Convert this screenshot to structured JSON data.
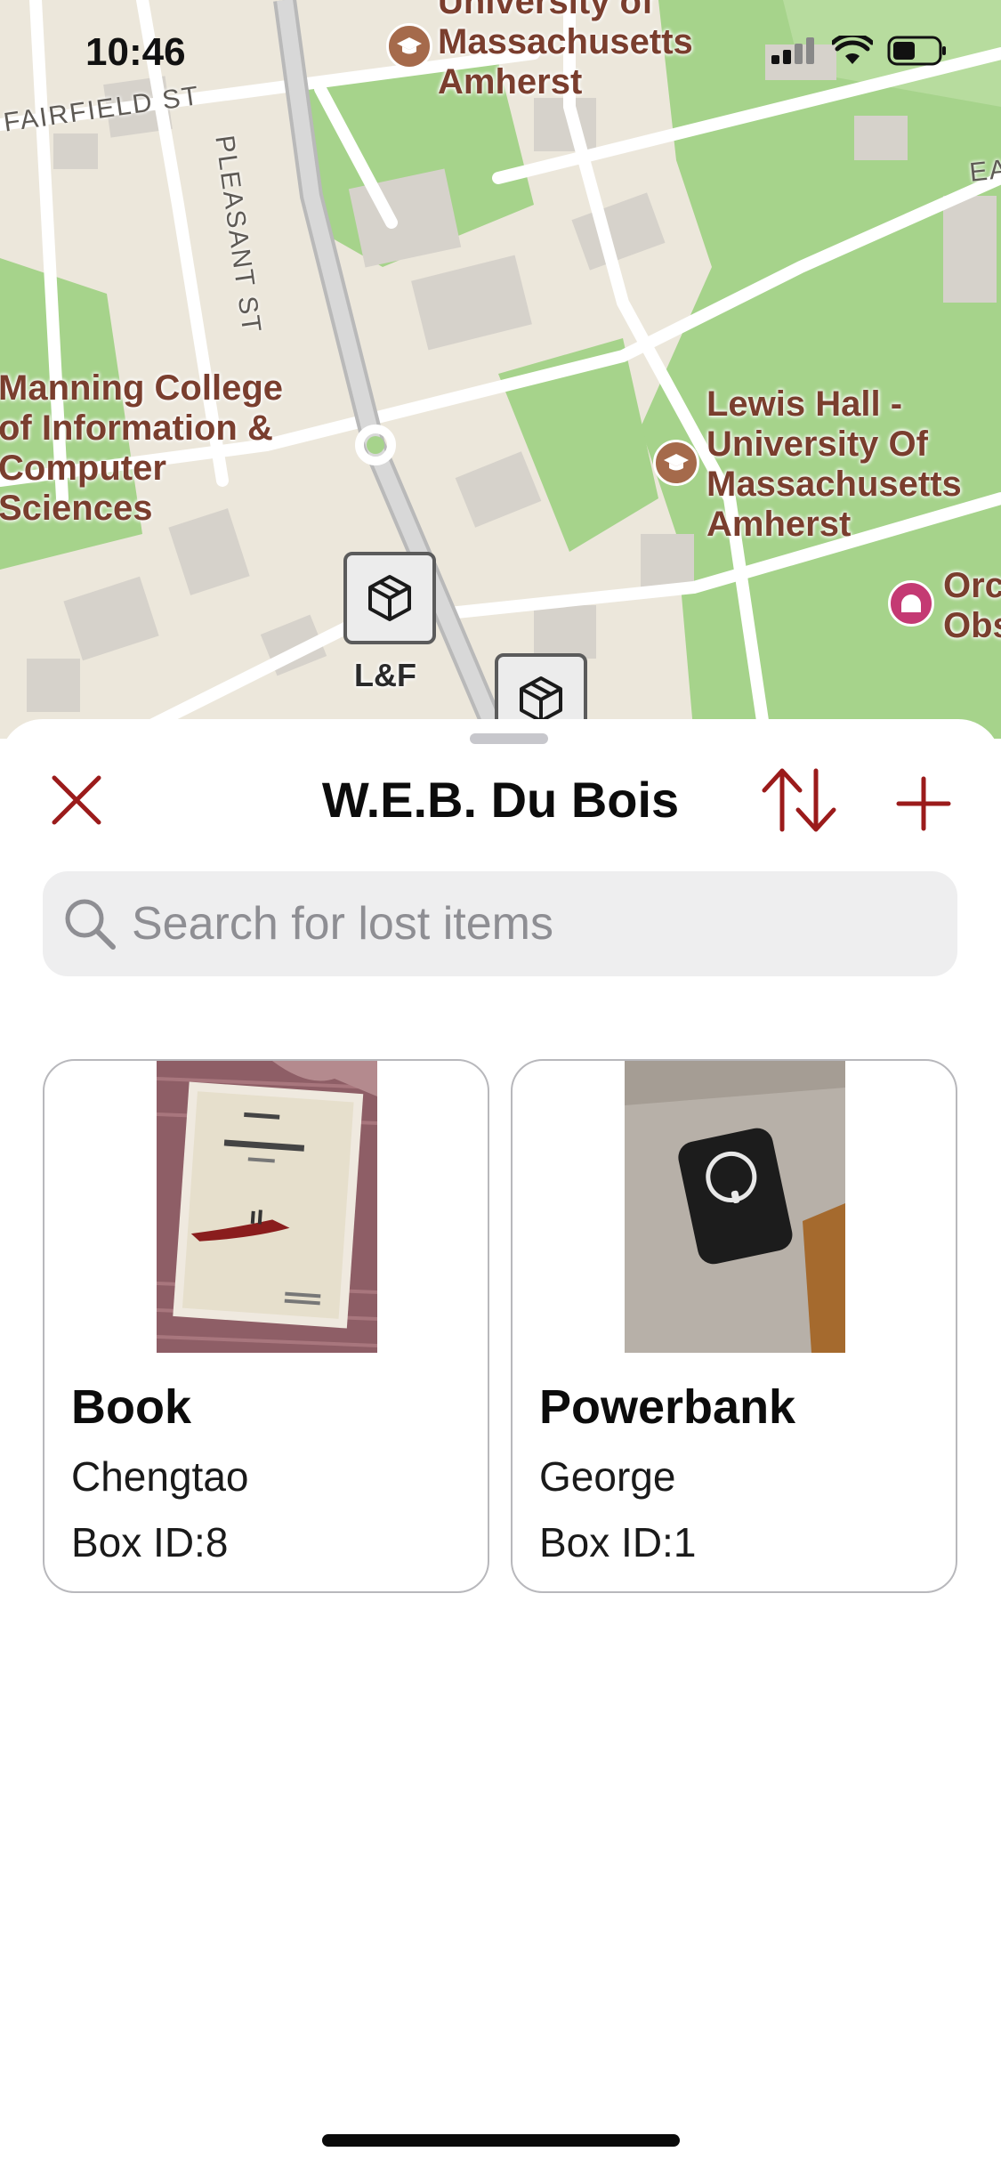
{
  "status_bar": {
    "time": "10:46"
  },
  "map": {
    "labels": {
      "umass": [
        "University of",
        "Massachusetts",
        "Amherst"
      ],
      "manning": [
        "Manning College",
        "of Information &",
        "Computer",
        "Sciences"
      ],
      "lewis": [
        "Lewis Hall -",
        "University Of",
        "Massachusetts",
        "Amherst"
      ],
      "orchard": [
        "Orc",
        "Obs"
      ],
      "pleasant_st": "PLEASANT ST",
      "fairfield_st": "FAIRFIELD ST",
      "east_st": "EA"
    },
    "markers": [
      {
        "label": "L&F"
      },
      {
        "label": ""
      }
    ]
  },
  "sheet": {
    "title": "W.E.B. Du Bois",
    "search_placeholder": "Search for lost items",
    "accent_color": "#9b1b1b"
  },
  "items": [
    {
      "name": "Book",
      "owner": "Chengtao",
      "box": "Box ID:8"
    },
    {
      "name": "Powerbank",
      "owner": "George",
      "box": "Box ID:1"
    }
  ],
  "icons": {
    "close": "close-icon",
    "sort": "sort-arrows-icon",
    "add": "plus-icon",
    "search": "search-icon",
    "box_marker": "box-icon",
    "campus_poi": "graduation-cap-icon"
  }
}
